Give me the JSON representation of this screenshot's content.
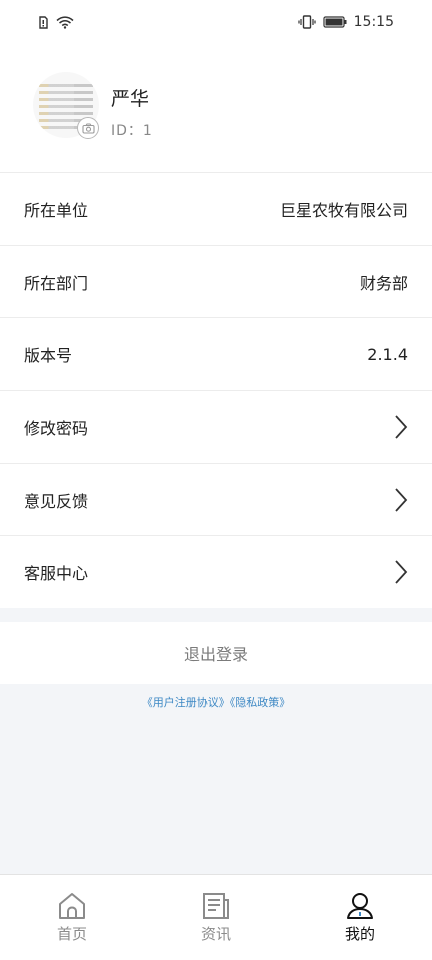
{
  "status_bar": {
    "time": "15:15",
    "left_icons": [
      "sim-icon",
      "wifi-icon"
    ],
    "right_icons": [
      "vibrate-icon",
      "battery-icon"
    ]
  },
  "profile": {
    "name": "严华",
    "id_text": "ID：1"
  },
  "info_rows": [
    {
      "label": "所在单位",
      "value": "巨星农牧有限公司"
    },
    {
      "label": "所在部门",
      "value": "财务部"
    },
    {
      "label": "版本号",
      "value": "2.1.4"
    }
  ],
  "nav_rows": [
    {
      "label": "修改密码"
    },
    {
      "label": "意见反馈"
    },
    {
      "label": "客服中心"
    }
  ],
  "logout_label": "退出登录",
  "policy_text": "《用户注册协议》《隐私政策》",
  "tabs": [
    {
      "label": "首页",
      "icon": "home-icon",
      "active": false
    },
    {
      "label": "资讯",
      "icon": "news-icon",
      "active": false
    },
    {
      "label": "我的",
      "icon": "profile-icon",
      "active": true
    }
  ],
  "colors": {
    "link": "#3d88c4",
    "background": "#f3f5f8"
  }
}
